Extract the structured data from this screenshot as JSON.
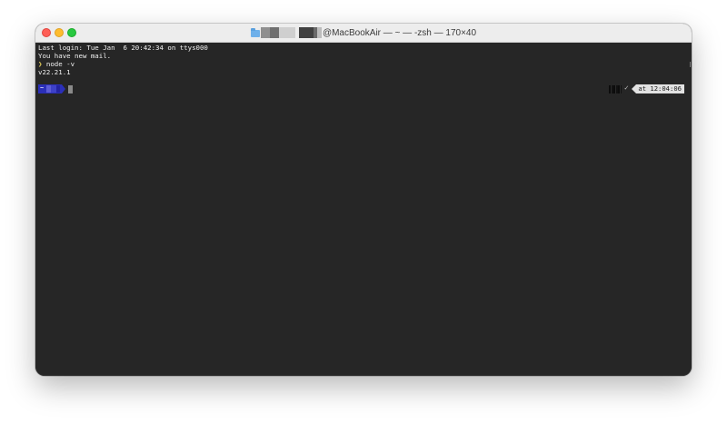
{
  "window": {
    "title_suffix": "@MacBookAir — ~ — -zsh — 170×40"
  },
  "terminal": {
    "lines": [
      "Last login: Tue Jan  6 20:42:34 on ttys000",
      "You have new mail.",
      "node -v",
      "v22.21.1"
    ],
    "prompt_symbol": "❯",
    "home_glyph": "~",
    "status_check": "✓",
    "time_label": "at 12:04:06"
  },
  "colors": {
    "terminal_bg": "#262626",
    "prompt_segment": "#2b2fb8",
    "time_badge_bg": "#e2e2e2"
  }
}
